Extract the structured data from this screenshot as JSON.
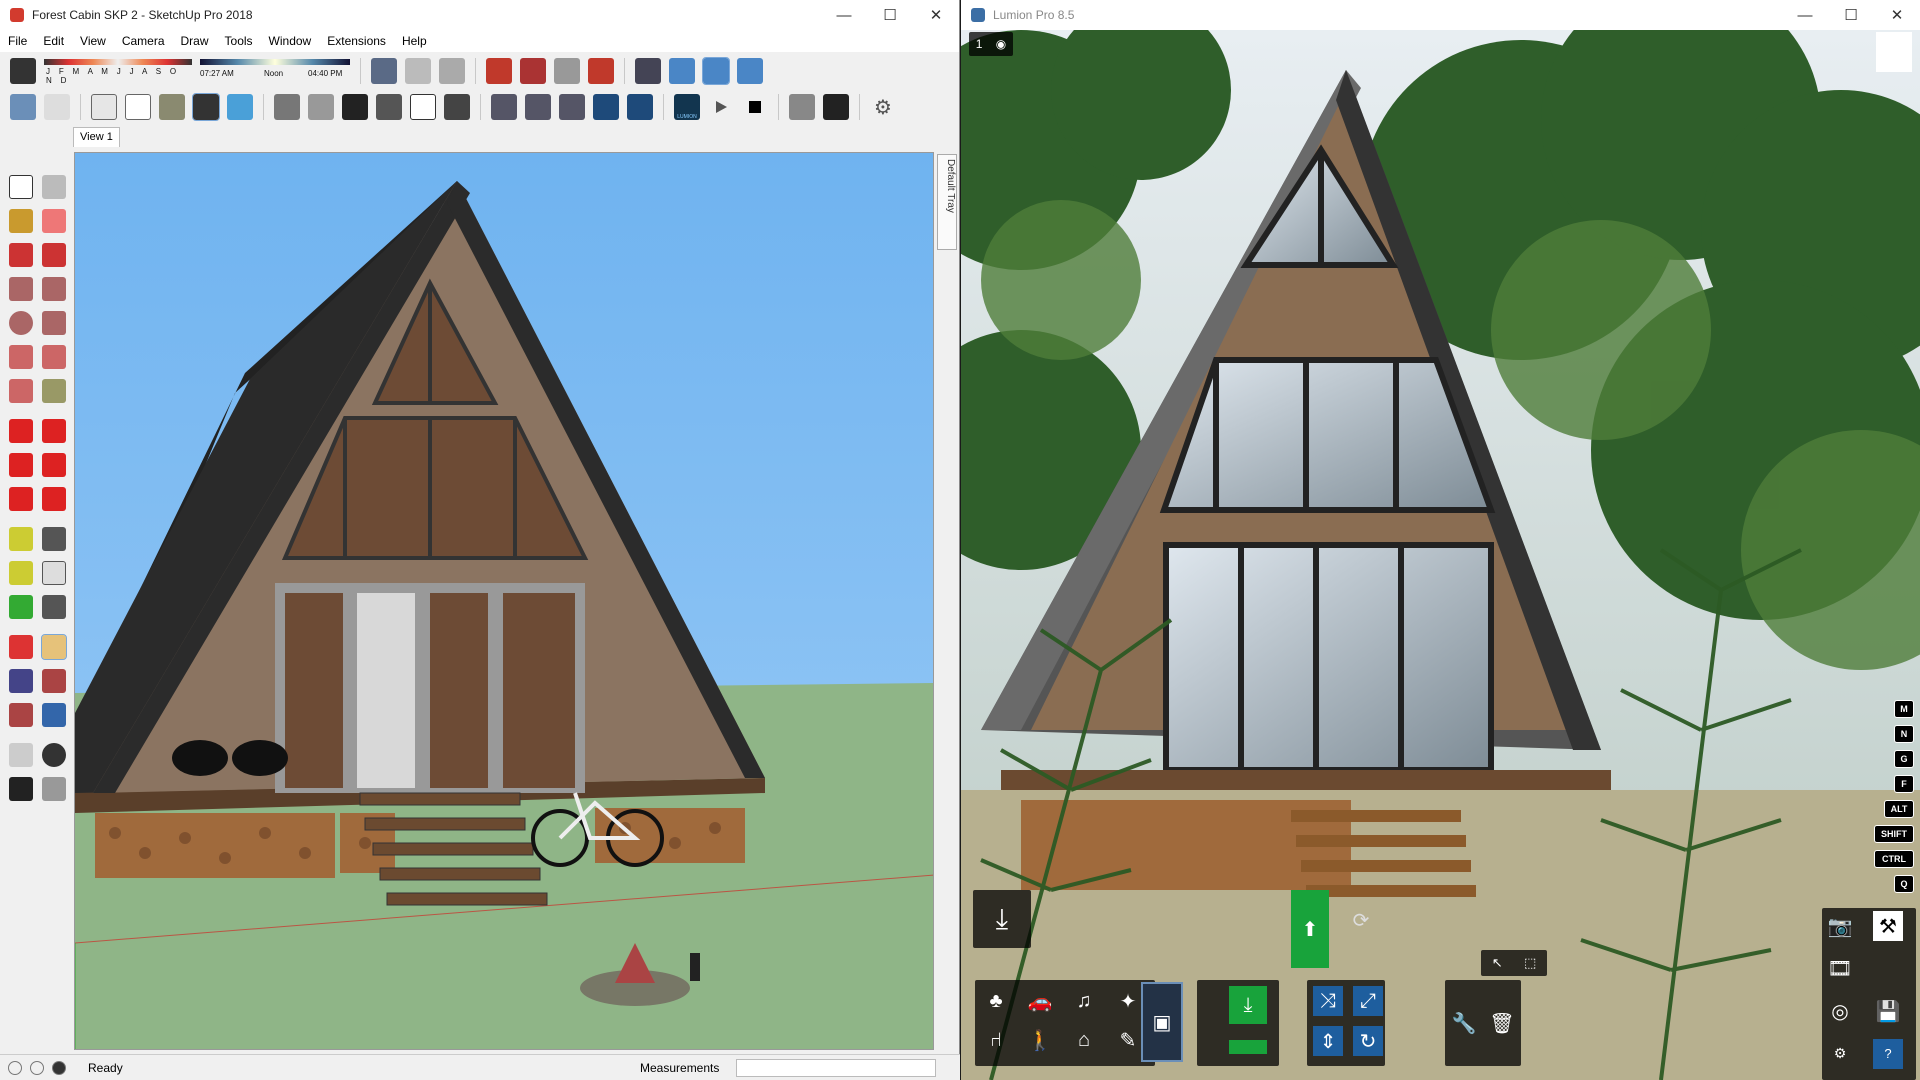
{
  "sketchup": {
    "window_title": "Forest Cabin SKP 2 - SketchUp Pro 2018",
    "menu": [
      "File",
      "Edit",
      "View",
      "Camera",
      "Draw",
      "Tools",
      "Window",
      "Extensions",
      "Help"
    ],
    "shadow_months": "J F M A M J J A S O N D",
    "time_start": "07:27 AM",
    "time_mid": "Noon",
    "time_end": "04:40 PM",
    "scene_tab": "View 1",
    "default_tray": "Default Tray",
    "status_text": "Ready",
    "measurements_label": "Measurements",
    "lumion_badge": "LUMION",
    "colors": {
      "sky": "#7fbdf2",
      "ground": "#8fb587",
      "selection": "#cfe3f7"
    }
  },
  "lumion": {
    "window_title": "Lumion Pro 8.5",
    "scene_number": "1",
    "keys": [
      "M",
      "N",
      "G",
      "F",
      "ALT",
      "SHIFT",
      "CTRL",
      "Q"
    ],
    "help": "?",
    "colors": {
      "accent_green": "#18a33b",
      "accent_blue": "#1e5e9e"
    }
  },
  "window_controls": {
    "minimize": "—",
    "maximize": "☐",
    "close": "✕"
  }
}
